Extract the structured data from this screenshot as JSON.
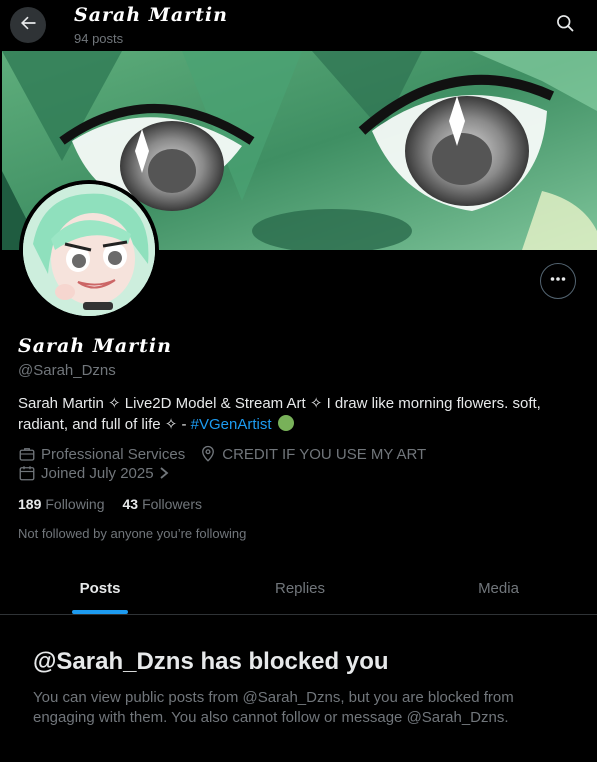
{
  "header": {
    "title": "Sarah Martin",
    "post_count": "94 posts",
    "back_icon": "arrow-left-icon",
    "search_icon": "search-icon"
  },
  "profile": {
    "display_name": "Sarah Martin",
    "handle": "@Sarah_Dzns",
    "bio_text": "Sarah Martin ✧ Live2D Model & Stream Art ✧ I draw like morning flowers. soft, radiant, and full of life ✧ - ",
    "bio_hashtag": "#VGenArtist",
    "category": "Professional Services",
    "location": "CREDIT IF YOU USE MY ART",
    "joined": "Joined July 2025",
    "following_count": "189",
    "following_label": "Following",
    "followers_count": "43",
    "followers_label": "Followers",
    "not_followed": "Not followed by anyone you’re following"
  },
  "tabs": [
    {
      "label": "Posts",
      "active": true
    },
    {
      "label": "Replies",
      "active": false
    },
    {
      "label": "Media",
      "active": false
    }
  ],
  "blocked": {
    "title": "@Sarah_Dzns has blocked you",
    "message": "You can view public posts from @Sarah_Dzns, but you are blocked from engaging with them. You also cannot follow or message @Sarah_Dzns."
  },
  "colors": {
    "background": "#000000",
    "accent": "#1d9bf0",
    "muted_text": "#71767b",
    "primary_text": "#e7e9ea",
    "border": "#2f3336"
  }
}
